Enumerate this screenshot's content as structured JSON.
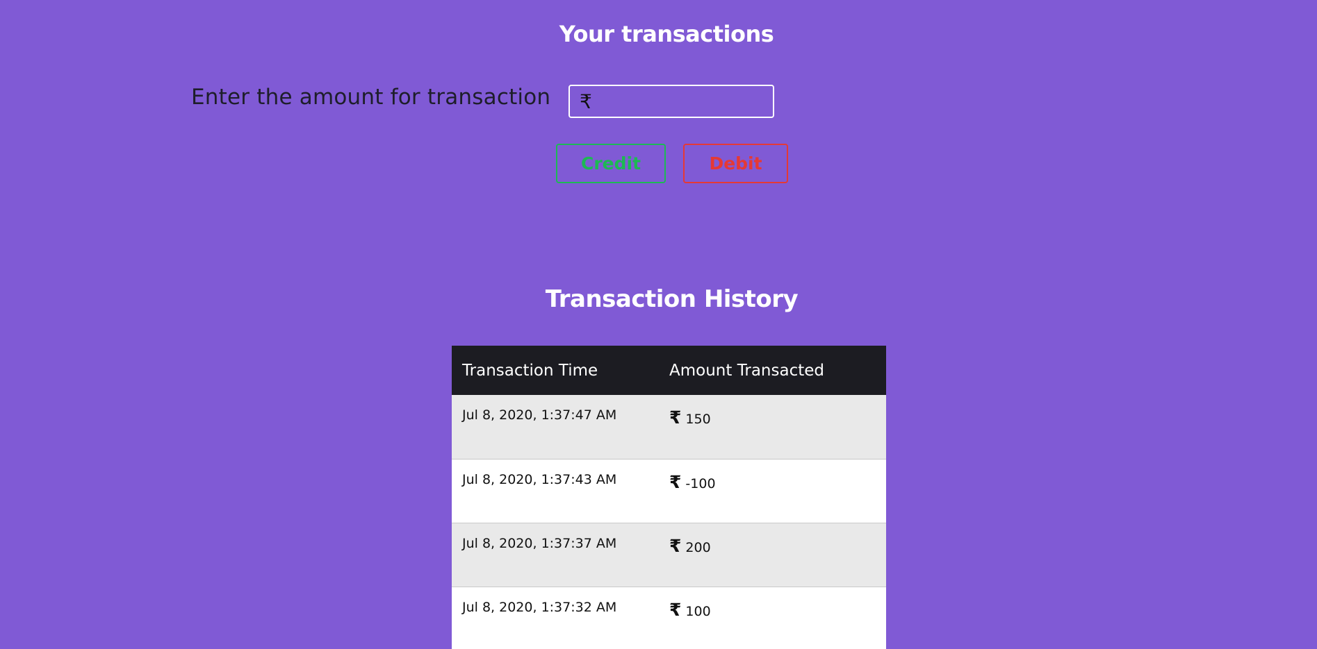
{
  "header": {
    "title": "Your transactions"
  },
  "form": {
    "amount_label": "Enter the amount for transaction",
    "currency_symbol": "₹",
    "amount_value": "",
    "credit_label": "Credit",
    "debit_label": "Debit"
  },
  "history": {
    "title": "Transaction History",
    "columns": [
      "Transaction Time",
      "Amount Transacted"
    ],
    "rows": [
      {
        "time": "Jul 8, 2020, 1:37:47 AM",
        "currency": "₹",
        "amount": "150"
      },
      {
        "time": "Jul 8, 2020, 1:37:43 AM",
        "currency": "₹",
        "amount": "-100"
      },
      {
        "time": "Jul 8, 2020, 1:37:37 AM",
        "currency": "₹",
        "amount": "200"
      },
      {
        "time": "Jul 8, 2020, 1:37:32 AM",
        "currency": "₹",
        "amount": "100"
      }
    ]
  },
  "colors": {
    "background": "#805ad5",
    "credit": "#1db954",
    "debit": "#e53935",
    "table_header": "#1c1c22"
  }
}
